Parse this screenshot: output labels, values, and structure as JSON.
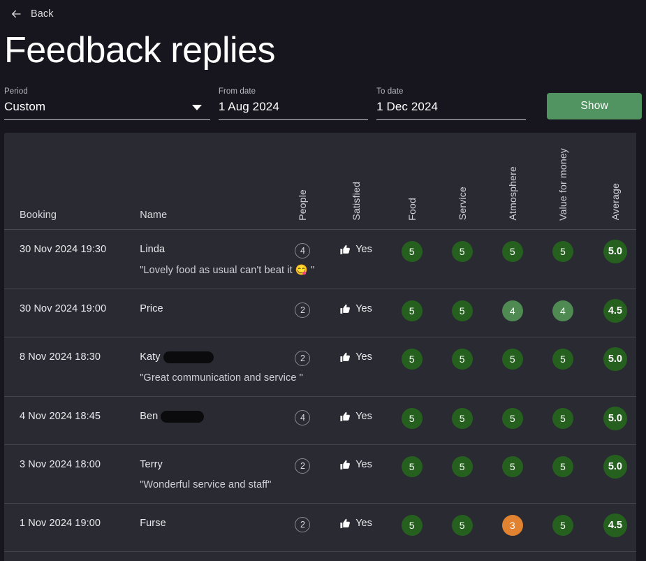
{
  "nav": {
    "back_label": "Back",
    "back_icon": "arrow-left-icon"
  },
  "header": {
    "title": "Feedback replies"
  },
  "filters": {
    "period": {
      "label": "Period",
      "value": "Custom",
      "caret_icon": "chevron-down-icon"
    },
    "from_date": {
      "label": "From date",
      "value": "1 Aug 2024"
    },
    "to_date": {
      "label": "To date",
      "value": "1 Dec 2024"
    },
    "show_button": "Show"
  },
  "table": {
    "columns": {
      "booking": "Booking",
      "name": "Name",
      "people": "People",
      "satisfied": "Satisfied",
      "food": "Food",
      "service": "Service",
      "atmosphere": "Atmosphere",
      "value_for_money": "Value for money",
      "average": "Average"
    },
    "rows": [
      {
        "booking": "30 Nov 2024 19:30",
        "name": "Linda",
        "redacted": false,
        "people": "4",
        "satisfied": "Yes",
        "comment": "\"Lovely food as usual can't beat it 😋 \"",
        "food": "5",
        "service": "5",
        "atmosphere": "5",
        "value_for_money": "5",
        "average": "5.0"
      },
      {
        "booking": "30 Nov 2024 19:00",
        "name": "Price",
        "redacted": false,
        "people": "2",
        "satisfied": "Yes",
        "comment": "",
        "food": "5",
        "service": "5",
        "atmosphere": "4",
        "value_for_money": "4",
        "average": "4.5"
      },
      {
        "booking": "8 Nov 2024 18:30",
        "name": "Katy",
        "redacted": true,
        "people": "2",
        "satisfied": "Yes",
        "comment": "\"Great communication and service \"",
        "food": "5",
        "service": "5",
        "atmosphere": "5",
        "value_for_money": "5",
        "average": "5.0"
      },
      {
        "booking": "4 Nov 2024 18:45",
        "name": "Ben",
        "redacted": true,
        "people": "4",
        "satisfied": "Yes",
        "comment": "",
        "food": "5",
        "service": "5",
        "atmosphere": "5",
        "value_for_money": "5",
        "average": "5.0"
      },
      {
        "booking": "3 Nov 2024 18:00",
        "name": "Terry",
        "redacted": false,
        "people": "2",
        "satisfied": "Yes",
        "comment": "\"Wonderful service and staff\"",
        "food": "5",
        "service": "5",
        "atmosphere": "5",
        "value_for_money": "5",
        "average": "5.0"
      },
      {
        "booking": "1 Nov 2024 19:00",
        "name": "Furse",
        "redacted": false,
        "people": "2",
        "satisfied": "Yes",
        "comment": "",
        "food": "5",
        "service": "5",
        "atmosphere": "3",
        "value_for_money": "5",
        "average": "4.5"
      }
    ]
  },
  "colors": {
    "page_background": "#17161f",
    "card_background": "#2a2a33",
    "score_5": "#26601f",
    "score_4": "#4f8a52",
    "score_3": "#e0822f",
    "show_button": "#519461",
    "row_divider": "#44444f"
  }
}
